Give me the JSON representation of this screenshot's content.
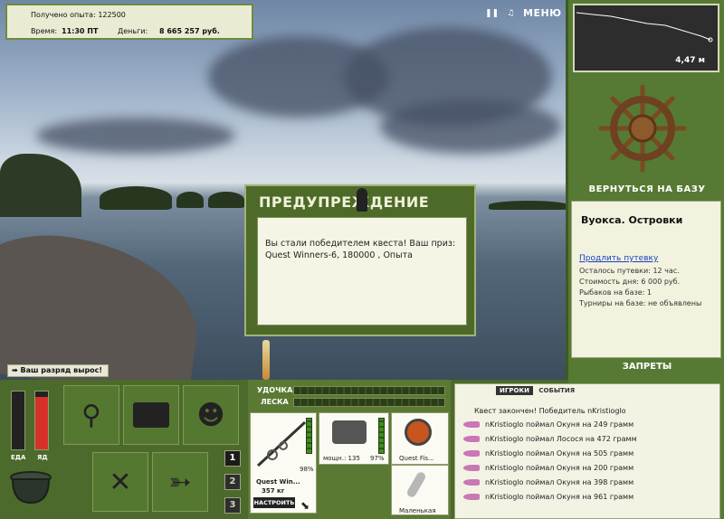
{
  "header": {
    "xp_label": "Получено опыта:",
    "xp_value": "122500",
    "time_label": "Время:",
    "time_value": "11:30 ПТ",
    "money_label": "Деньги:",
    "money_value": "8 665 257 руб.",
    "menu_label": "МЕНЮ"
  },
  "depth": {
    "value": "4,47 м"
  },
  "base": {
    "return_label": "ВЕРНУТЬСЯ НА БАЗУ",
    "name": "Вуокса. Островки",
    "extend_link": "Продлить путевку",
    "remaining": "Осталось путевки: 12 час.",
    "cost": "Стоимость дня: 6 000 руб.",
    "fishers": "Рыбаков на базе: 1",
    "tournaments": "Турниры на базе: не объявлены",
    "bans_label": "ЗАПРЕТЫ"
  },
  "dialog": {
    "title": "ПРЕДУПРЕЖДЕНИЕ",
    "message": "Вы стали победителем квеста! Ваш приз: Quest Winners-6, 180000 , Опыта"
  },
  "notification": "Ваш разряд вырос!",
  "gauges": {
    "food_label": "ЕДА",
    "food_level": 0.0,
    "poison_label": "ЯД",
    "poison_level": 0.9,
    "poison_color": "#d6322a"
  },
  "page_buttons": [
    "1",
    "2",
    "3"
  ],
  "tackle": {
    "rod_label": "УДОЧКА",
    "line_label": "ЛЕСКА",
    "rod_name": "Quest Win...",
    "rod_weight": "357 кг",
    "rod_percent": "98%",
    "reel_power": "мощн.: 135",
    "reel_percent": "97%",
    "line_name": "Quest Fis...",
    "lure_name": "Маленькая",
    "setup_label": "НАСТРОИТЬ"
  },
  "events": {
    "tabs": [
      "ИГРОКИ",
      "СОБЫТИЯ"
    ],
    "headline": "Квест закончен! Победитель nKristioglo",
    "lines": [
      "nKristioglo поймал Окуня на 249 грамм",
      "nKristioglo поймал Лосося на 472 грамм",
      "nKristioglo поймал Окуня на 505 грамм",
      "nKristioglo поймал Окуня на 200 грамм",
      "nKristioglo поймал Окуня на 398 грамм",
      "nKristioglo поймал Окуня на 961 грамм"
    ]
  }
}
